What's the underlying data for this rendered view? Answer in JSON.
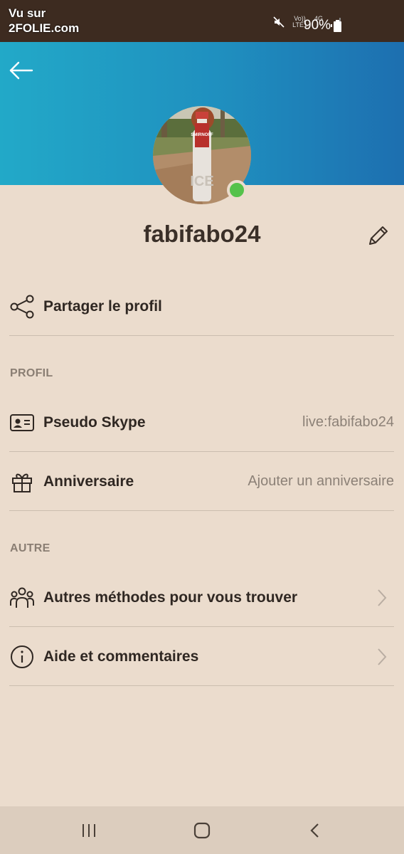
{
  "status_bar": {
    "watermark_line1": "Vu sur",
    "watermark_line2": "2FOLIE.com",
    "volte": "Vo))",
    "lte": "LTE1",
    "net": "4G",
    "battery": "90%"
  },
  "profile": {
    "username": "fabifabo24"
  },
  "actions": {
    "share_label": "Partager le profil"
  },
  "sections": {
    "profile_title": "PROFIL",
    "other_title": "AUTRE"
  },
  "profile_rows": [
    {
      "label": "Pseudo Skype",
      "value": "live:fabifabo24",
      "icon": "contact-card-icon"
    },
    {
      "label": "Anniversaire",
      "value": "Ajouter un anniversaire",
      "icon": "gift-icon"
    }
  ],
  "other_rows": [
    {
      "label": "Autres méthodes pour vous trouver",
      "icon": "people-icon"
    },
    {
      "label": "Aide et commentaires",
      "icon": "info-icon"
    }
  ],
  "avatar_photo": {
    "bottle_label": "SMIRNOFF",
    "bottle_text": "ICE"
  },
  "colors": {
    "header_gradient_start": "#22a9c8",
    "header_gradient_end": "#1d6fb0",
    "background": "#ebdccd",
    "presence_online": "#55c24b"
  }
}
